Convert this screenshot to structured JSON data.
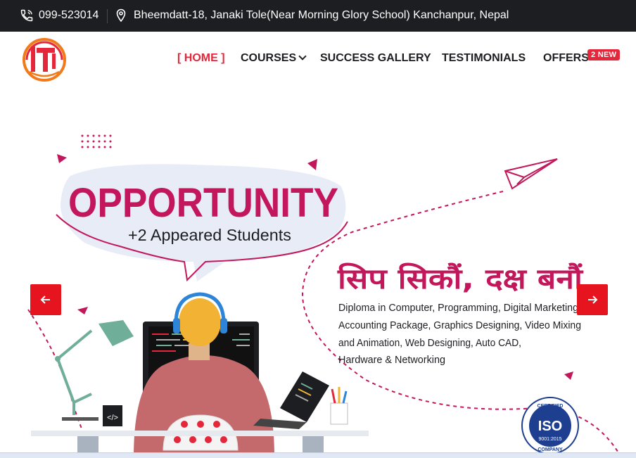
{
  "topbar": {
    "phone": "099-523014",
    "address": "Bheemdatt-18, Janaki Tole(Near Morning Glory School) Kanchanpur, Nepal"
  },
  "nav": {
    "home": "[ HOME ]",
    "courses": "COURSES",
    "gallery": "SUCCESS GALLERY",
    "testimonials": "TESTIMONIALS",
    "offers": "OFFERS",
    "offers_badge": "2 NEW"
  },
  "hero": {
    "headline": "OPPORTUNITY",
    "subheadline": "+2 Appeared Students",
    "nepali_tagline": "सिप सिकौं, दक्ष बनौं",
    "courses_lines": [
      "Diploma in Computer, Programming, Digital Marketing,",
      "Accounting Package, Graphics Designing, Video Mixing",
      "and Animation, Web Designing, Auto CAD,",
      "Hardware & Networking"
    ],
    "iso": {
      "top": "CERTIFIED",
      "main": "ISO",
      "number": "9001:2015",
      "bottom": "COMPANY"
    },
    "code_tag": "</>"
  },
  "colors": {
    "brand_red": "#e5273b",
    "magenta": "#c2185b",
    "topbar_bg": "#1d1e22"
  }
}
